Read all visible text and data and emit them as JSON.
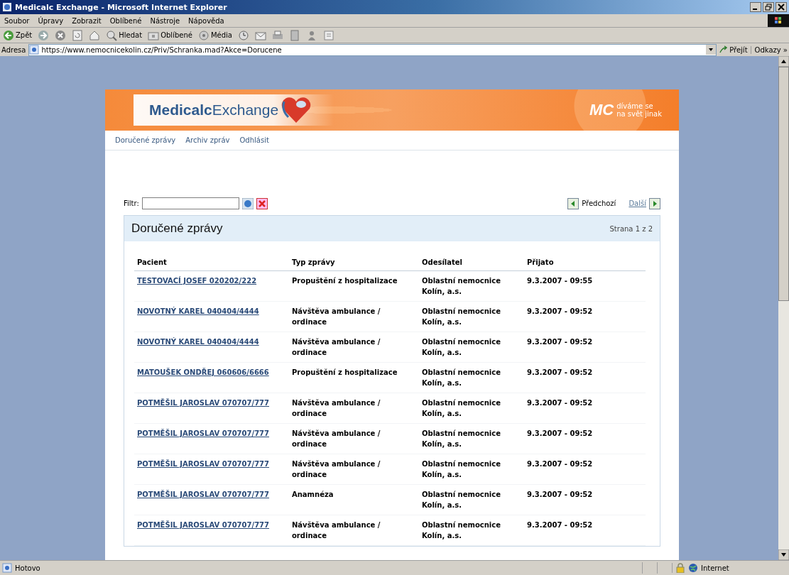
{
  "window": {
    "title": "Medicalc Exchange - Microsoft Internet Explorer"
  },
  "menu": [
    "Soubor",
    "Úpravy",
    "Zobrazit",
    "Oblíbené",
    "Nástroje",
    "Nápověda"
  ],
  "toolbar": [
    {
      "kind": "back",
      "label": "Zpět"
    },
    {
      "kind": "forward"
    },
    {
      "kind": "stop"
    },
    {
      "kind": "refresh"
    },
    {
      "kind": "home"
    },
    {
      "kind": "search",
      "label": "Hledat"
    },
    {
      "kind": "favorites",
      "label": "Oblíbené"
    },
    {
      "kind": "media",
      "label": "Média"
    },
    {
      "kind": "history"
    },
    {
      "kind": "mail"
    },
    {
      "kind": "print"
    },
    {
      "kind": "edit"
    },
    {
      "kind": "messenger"
    },
    {
      "kind": "research"
    }
  ],
  "address": {
    "label": "Adresa",
    "value": "https://www.nemocnicekolin.cz/Priv/Schranka.mad?Akce=Dorucene",
    "go": "Přejít",
    "links": "Odkazy »"
  },
  "site": {
    "logo": "**Medicalc**Exchange",
    "mark": "MC",
    "tagline": [
      "díváme se",
      "na svět jinak"
    ]
  },
  "nav": [
    "Doručené zprávy",
    "Archiv zpráv",
    "Odhlásit"
  ],
  "filter": {
    "label": "Filtr:"
  },
  "pager": {
    "previous": "Předchozí",
    "next": "Další"
  },
  "panel": {
    "title": "Doručené zprávy",
    "page": "Strana 1 z 2"
  },
  "table": {
    "columns": [
      "Pacient",
      "Typ zprávy",
      "Odesílatel",
      "Přijato"
    ],
    "rows": [
      [
        "TESTOVACÍ JOSEF 020202/222",
        "Propuštění z hospitalizace",
        "Oblastní nemocnice Kolín, a.s.",
        "9.3.2007 - 09:55"
      ],
      [
        "NOVOTNÝ KAREL 040404/4444",
        "Návštěva ambulance / ordinace",
        "Oblastní nemocnice Kolín, a.s.",
        "9.3.2007 - 09:52"
      ],
      [
        "NOVOTNÝ KAREL 040404/4444",
        "Návštěva ambulance / ordinace",
        "Oblastní nemocnice Kolín, a.s.",
        "9.3.2007 - 09:52"
      ],
      [
        "MATOUŠEK ONDŘEJ 060606/6666",
        "Propuštění z hospitalizace",
        "Oblastní nemocnice Kolín, a.s.",
        "9.3.2007 - 09:52"
      ],
      [
        "POTMĚŠIL JAROSLAV 070707/777",
        "Návštěva ambulance / ordinace",
        "Oblastní nemocnice Kolín, a.s.",
        "9.3.2007 - 09:52"
      ],
      [
        "POTMĚŠIL JAROSLAV 070707/777",
        "Návštěva ambulance / ordinace",
        "Oblastní nemocnice Kolín, a.s.",
        "9.3.2007 - 09:52"
      ],
      [
        "POTMĚŠIL JAROSLAV 070707/777",
        "Návštěva ambulance / ordinace",
        "Oblastní nemocnice Kolín, a.s.",
        "9.3.2007 - 09:52"
      ],
      [
        "POTMĚŠIL JAROSLAV 070707/777",
        "Anamnéza",
        "Oblastní nemocnice Kolín, a.s.",
        "9.3.2007 - 09:52"
      ],
      [
        "POTMĚŠIL JAROSLAV 070707/777",
        "Návštěva ambulance / ordinace",
        "Oblastní nemocnice Kolín, a.s.",
        "9.3.2007 - 09:52"
      ]
    ]
  },
  "status_bar": {
    "text": "Hotovo",
    "zone": "Internet"
  }
}
